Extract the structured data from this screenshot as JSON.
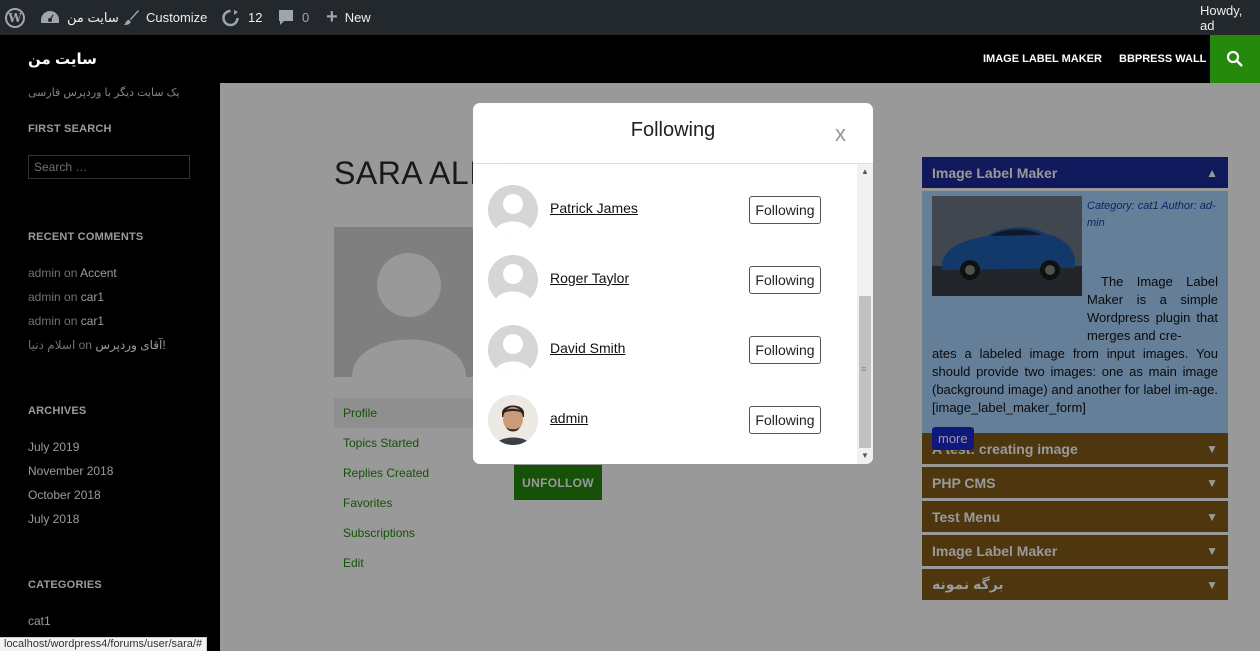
{
  "adminbar": {
    "site_name": "سایت من",
    "customize": "Customize",
    "updates": "12",
    "comments": "0",
    "new": "New",
    "howdy": "Howdy, ad"
  },
  "header": {
    "site_title": "سایت من",
    "nav": [
      "IMAGE LABEL MAKER",
      "BBPRESS WALL"
    ]
  },
  "left_sidebar": {
    "tagline": "یک سایت دیگر با وردپرس فارسی",
    "search_title": "FIRST SEARCH",
    "search_placeholder": "Search …",
    "recent_comments_title": "RECENT COMMENTS",
    "comments": [
      {
        "author": "admin",
        "on": "on",
        "post": "Accent"
      },
      {
        "author": "admin",
        "on": "on",
        "post": "car1"
      },
      {
        "author": "admin",
        "on": "on",
        "post": "car1"
      },
      {
        "author": "اسلام دنیا",
        "on": "on",
        "post": "آقای وردپرس!"
      }
    ],
    "archives_title": "ARCHIVES",
    "archives": [
      "July 2019",
      "November 2018",
      "October 2018",
      "July 2018"
    ],
    "categories_title": "CATEGORIES",
    "categories": [
      "cat1"
    ]
  },
  "profile": {
    "title": "SARA ALIS",
    "nav": [
      "Profile",
      "Topics Started",
      "Replies Created",
      "Favorites",
      "Subscriptions",
      "Edit"
    ],
    "unfollow": "UNFOLLOW"
  },
  "right_widget": {
    "open_title": "Image Label Maker",
    "meta_category_label": "Category:",
    "meta_category": "cat1",
    "meta_author_label": "Author:",
    "meta_author": "ad-min",
    "body_top": "The Image Label Maker is a simple Wordpress plugin that merges and cre-",
    "body_rest": "ates a labeled image from input images. You should provide two images: one as main image (background image) and another for label im-age. [image_label_maker_form]",
    "more": "more",
    "items": [
      "A test: creating image",
      "PHP CMS",
      "Test Menu",
      "Image Label Maker",
      "برگه نمونه"
    ]
  },
  "modal": {
    "title": "Following",
    "close": "x",
    "users": [
      {
        "name": "Patrick James",
        "button": "Following"
      },
      {
        "name": "Roger Taylor",
        "button": "Following"
      },
      {
        "name": "David Smith",
        "button": "Following"
      },
      {
        "name": "admin",
        "button": "Following"
      }
    ]
  },
  "statusbar": "localhost/wordpress4/forums/user/sara/#",
  "colors": {
    "accent_green": "#24890d",
    "admin_bar": "#23282d",
    "widget_brown": "#825b19",
    "widget_blue": "#1a2a98"
  }
}
